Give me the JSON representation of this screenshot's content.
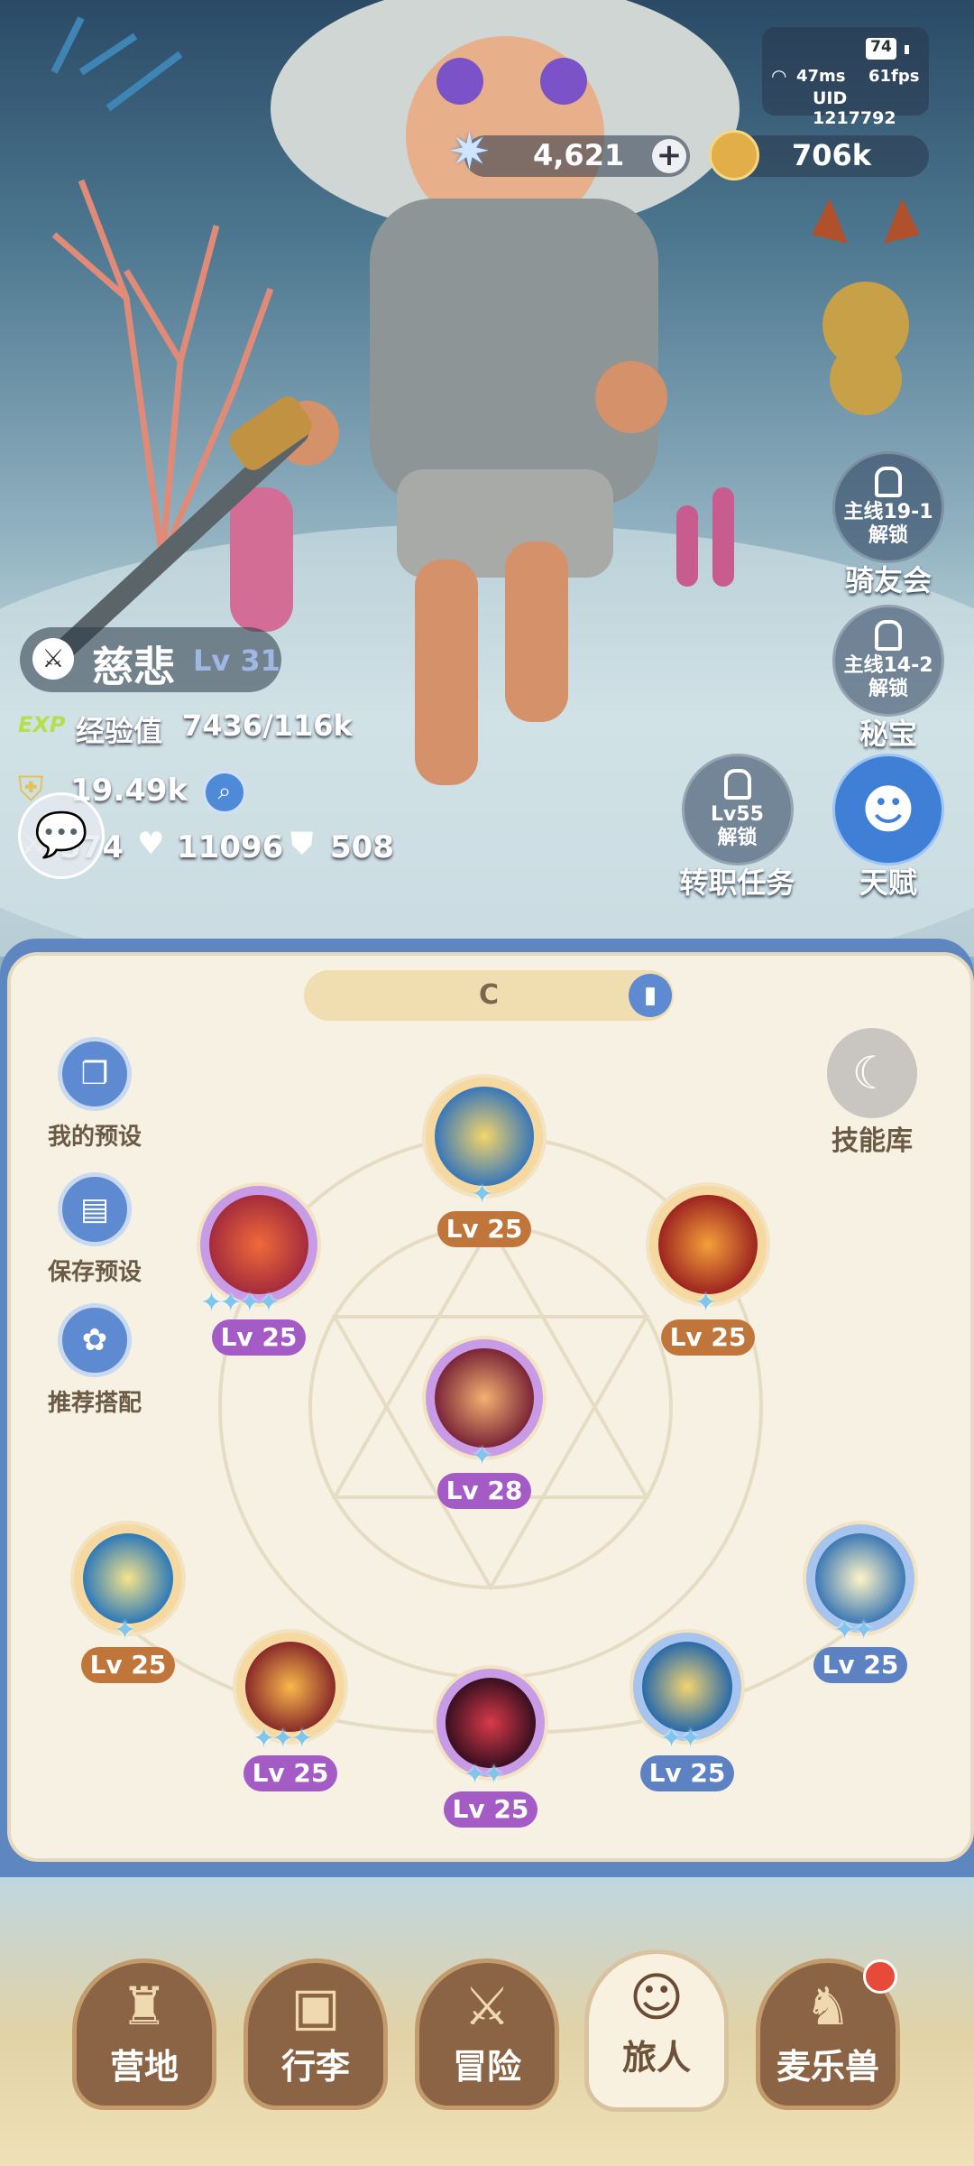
{
  "hud": {
    "signal_icon": "wifi-icon",
    "ping": "47ms",
    "fps": "61fps",
    "battery": "74",
    "uid": "UID 1217792",
    "gems": "4,621",
    "coins": "706k",
    "add_label": "+"
  },
  "player": {
    "name": "慈悲",
    "level": "Lv 31",
    "exp_badge": "EXP",
    "exp_label": "经验值",
    "exp_value": "7436/116k",
    "power": "19.49k",
    "attack": "574",
    "hp": "11096",
    "defense": "508"
  },
  "side_buttons": [
    {
      "req": "主线19-1",
      "lock_text": "解锁",
      "name": "骑友会"
    },
    {
      "req": "主线14-2",
      "lock_text": "解锁",
      "name": "秘宝"
    },
    {
      "req": "Lv55",
      "lock_text": "解锁",
      "name": "转职任务"
    },
    {
      "name": "天赋"
    }
  ],
  "panel": {
    "preset_name": "C",
    "library_label": "技能库",
    "presets": [
      {
        "label": "我的预设"
      },
      {
        "label": "保存预设"
      },
      {
        "label": "推荐搭配"
      }
    ]
  },
  "skills": [
    {
      "level": "Lv 25",
      "stars": "✦",
      "color": "orange"
    },
    {
      "level": "Lv 25",
      "stars": "✦✦✦✦",
      "color": "purple"
    },
    {
      "level": "Lv 25",
      "stars": "✦",
      "color": "orange"
    },
    {
      "level": "Lv 28",
      "stars": "✦",
      "color": "purple"
    },
    {
      "level": "Lv 25",
      "stars": "✦",
      "color": "orange"
    },
    {
      "level": "Lv 25",
      "stars": "✦✦✦",
      "color": "purple"
    },
    {
      "level": "Lv 25",
      "stars": "✦✦",
      "color": "purple"
    },
    {
      "level": "Lv 25",
      "stars": "✦✦",
      "color": "blue"
    },
    {
      "level": "Lv 25",
      "stars": "✦✦",
      "color": "blue"
    }
  ],
  "nav": [
    {
      "label": "营地",
      "icon": "castle-icon"
    },
    {
      "label": "行李",
      "icon": "backpack-icon"
    },
    {
      "label": "冒险",
      "icon": "crossed-swords-icon"
    },
    {
      "label": "旅人",
      "icon": "traveler-icon"
    },
    {
      "label": "麦乐兽",
      "icon": "pet-icon"
    }
  ]
}
